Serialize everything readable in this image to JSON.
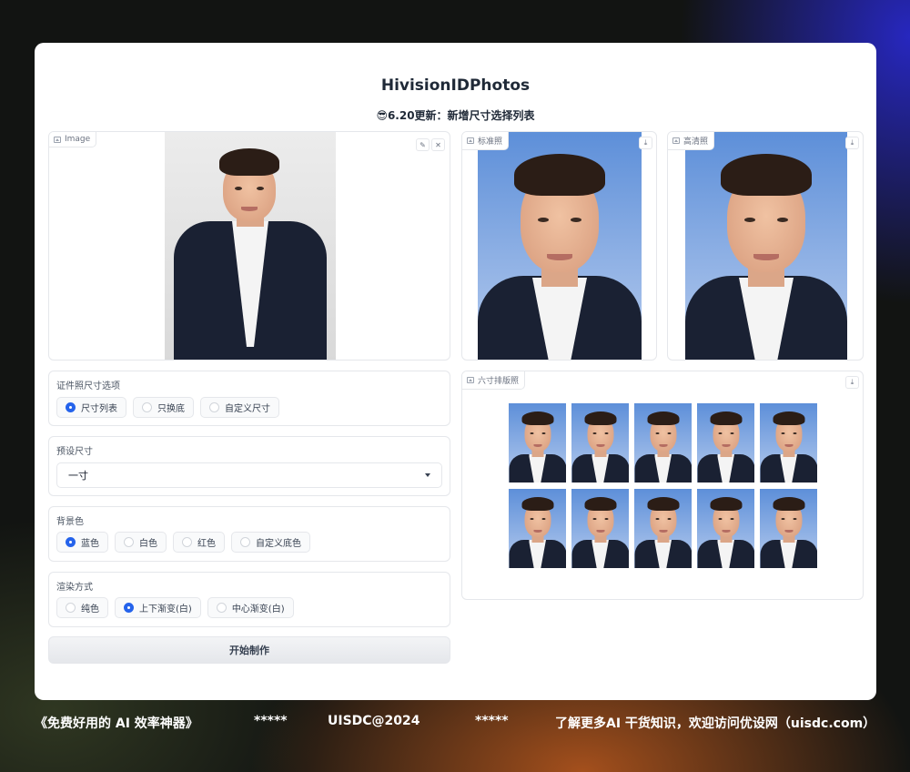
{
  "app": {
    "title": "HivisionIDPhotos",
    "subtitle_icon": "😎",
    "subtitle": "6.20更新：新增尺寸选择列表"
  },
  "input_image": {
    "label": "Image",
    "edit_icon": "pencil-icon",
    "clear_icon": "close-icon"
  },
  "outputs": {
    "standard_label": "标准照",
    "hd_label": "高清照",
    "layout_label": "六寸排版照",
    "download_icon": "download-icon"
  },
  "size_options": {
    "label": "证件照尺寸选项",
    "options": [
      "尺寸列表",
      "只换底",
      "自定义尺寸"
    ],
    "selected": "尺寸列表"
  },
  "preset_size": {
    "label": "预设尺寸",
    "value": "一寸"
  },
  "background_color": {
    "label": "背景色",
    "options": [
      "蓝色",
      "白色",
      "红色",
      "自定义底色"
    ],
    "selected": "蓝色",
    "color": "#5d8fd9"
  },
  "render_mode": {
    "label": "渲染方式",
    "options": [
      "纯色",
      "上下渐变(白)",
      "中心渐变(白)"
    ],
    "selected": "上下渐变(白)"
  },
  "submit_label": "开始制作",
  "footer": {
    "left": "《免费好用的 AI 效率神器》",
    "stars_left": "*****",
    "center": "UISDC@2024",
    "stars_right": "*****",
    "right": "了解更多AI 干货知识，欢迎访问优设网（uisdc.com）"
  }
}
